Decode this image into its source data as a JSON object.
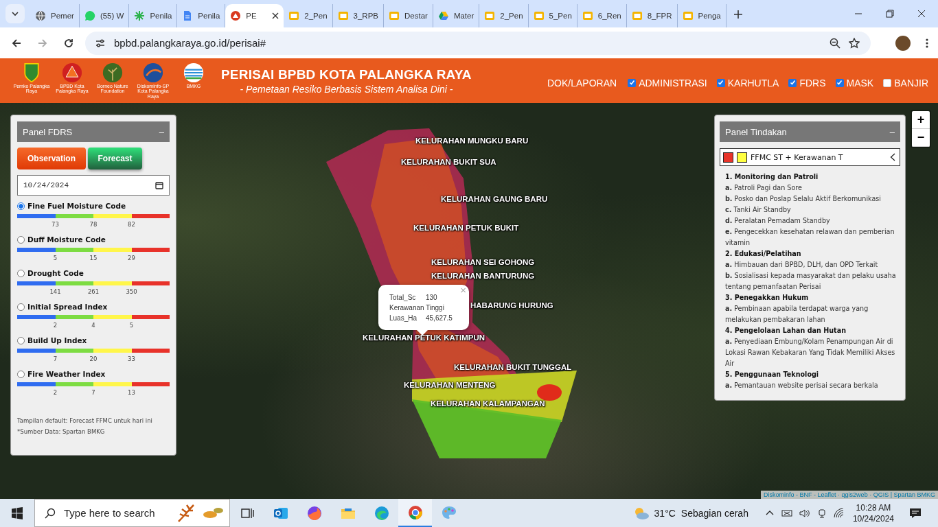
{
  "browser": {
    "tabs": [
      {
        "title": "Pemer",
        "kind": "globe",
        "selected": false
      },
      {
        "title": "(55) W",
        "kind": "chat",
        "selected": false
      },
      {
        "title": "Penila",
        "kind": "spark",
        "selected": false
      },
      {
        "title": "Penila",
        "kind": "doc",
        "selected": false
      },
      {
        "title": "PE",
        "kind": "emblem",
        "selected": true
      },
      {
        "title": "2_Pen",
        "kind": "slides",
        "selected": false
      },
      {
        "title": "3_RPB",
        "kind": "slides",
        "selected": false
      },
      {
        "title": "Destar",
        "kind": "slides",
        "selected": false
      },
      {
        "title": "Mater",
        "kind": "drive",
        "selected": false
      },
      {
        "title": "2_Pen",
        "kind": "slides",
        "selected": false
      },
      {
        "title": "5_Pen",
        "kind": "slides",
        "selected": false
      },
      {
        "title": "6_Ren",
        "kind": "slides",
        "selected": false
      },
      {
        "title": "8_FPR",
        "kind": "slides",
        "selected": false
      },
      {
        "title": "Penga",
        "kind": "slides",
        "selected": false
      }
    ],
    "url": "bpbd.palangkaraya.go.id/perisai#"
  },
  "header": {
    "logos": [
      {
        "caption": "Pemko Palangka Raya",
        "kind": "shield"
      },
      {
        "caption": "BPBD Kota Palangka Raya",
        "kind": "triangle"
      },
      {
        "caption": "Borneo Nature Foundation",
        "kind": "tree"
      },
      {
        "caption": "Diskominfo-SP Kota Palangka Raya",
        "kind": "swirl"
      },
      {
        "caption": "BMKG",
        "kind": "globe"
      }
    ],
    "title": "PERISAI BPBD KOTA PALANGKA RAYA",
    "subtitle": "- Pemetaan Resiko Berbasis Sistem Analisa Dini -",
    "nav": [
      {
        "label": "DOK/LAPORAN",
        "kind": "link"
      },
      {
        "label": "ADMINISTRASI",
        "kind": "checkbox",
        "checked": true
      },
      {
        "label": "KARHUTLA",
        "kind": "checkbox",
        "checked": true
      },
      {
        "label": "FDRS",
        "kind": "checkbox",
        "checked": true
      },
      {
        "label": "MASK",
        "kind": "checkbox",
        "checked": true
      },
      {
        "label": "BANJIR",
        "kind": "checkbox",
        "checked": false
      }
    ]
  },
  "fdrs_panel": {
    "title": "Panel FDRS",
    "collapse": "–",
    "buttons": [
      {
        "label": "Observation",
        "kind": "primary"
      },
      {
        "label": "Forecast",
        "kind": "secondary"
      }
    ],
    "date": "10/24/2024",
    "indices": [
      {
        "name": "Fine Fuel Moisture Code",
        "selected": true,
        "thresholds": [
          "73",
          "78",
          "82"
        ]
      },
      {
        "name": "Duff Moisture Code",
        "selected": false,
        "thresholds": [
          "5",
          "15",
          "29"
        ]
      },
      {
        "name": "Drought Code",
        "selected": false,
        "thresholds": [
          "141",
          "261",
          "350"
        ]
      },
      {
        "name": "Initial Spread Index",
        "selected": false,
        "thresholds": [
          "2",
          "4",
          "5"
        ]
      },
      {
        "name": "Build Up Index",
        "selected": false,
        "thresholds": [
          "7",
          "20",
          "33"
        ]
      },
      {
        "name": "Fire Weather Index",
        "selected": false,
        "thresholds": [
          "2",
          "7",
          "13"
        ]
      }
    ],
    "notes": [
      "Tampilan default: Forecast FFMC untuk hari ini",
      "*Sumber Data: Spartan BMKG"
    ]
  },
  "action_panel": {
    "title": "Panel Tindakan",
    "collapse": "–",
    "legend": {
      "label": "FFMC ST + Kerawanan T",
      "swatches": [
        {
          "color": "#e8342a"
        },
        {
          "color": "#ffff40"
        }
      ]
    },
    "sections": [
      {
        "heading": "1. Monitoring dan Patroli",
        "items": [
          "**a.** Patroli Pagi dan Sore",
          "**b.** Posko dan Poslap Selalu Aktif Berkomunikasi",
          "**c.** Tanki Air Standby",
          "**d.** Peralatan Pemadam Standby",
          "**e.** Pengecekkan kesehatan relawan dan pemberian vitamin"
        ]
      },
      {
        "heading": "2. Edukasi/Pelatihan",
        "items": [
          "**a.** Himbauan dari BPBD, DLH, dan OPD Terkait",
          "**b.** Sosialisasi kepada masyarakat dan pelaku usaha tentang pemanfaatan Perisai"
        ]
      },
      {
        "heading": "3. Penegakkan Hukum",
        "items": [
          "**a.** Pembinaan apabila terdapat warga yang melakukan pembakaran lahan"
        ]
      },
      {
        "heading": "4. Pengelolaan Lahan dan Hutan",
        "items": [
          "**a.** Penyediaan Embung/Kolam Penampungan Air di Lokasi Rawan Kebakaran Yang Tidak Memiliki Akses Air"
        ]
      },
      {
        "heading": "5. Penggunaan Teknologi",
        "items": [
          "**a.** Pemantauan website perisai secara berkala"
        ]
      }
    ]
  },
  "map": {
    "labels": [
      {
        "text": "KELURAHAN MUNGKU BARU"
      },
      {
        "text": "KELURAHAN BUKIT SUA"
      },
      {
        "text": "KELURAHAN GAUNG BARU"
      },
      {
        "text": "KELURAHAN PETUK BUKIT"
      },
      {
        "text": "KELURAHAN SEI GOHONG"
      },
      {
        "text": "KELURAHAN BANTURUNG"
      },
      {
        "text": "HABARUNG HURUNG"
      },
      {
        "text": "KELURAHAN PETUK KATIMPUN"
      },
      {
        "text": "KELURAHAN BUKIT TUNGGAL"
      },
      {
        "text": "KELURAHAN MENTENG"
      },
      {
        "text": "KELURAHAN KALAMPANGAN"
      }
    ],
    "popup": {
      "close": "×",
      "rows": [
        {
          "key": "Total_Sc",
          "value": "130"
        },
        {
          "key": "Kerawanan",
          "value": "Tinggi"
        },
        {
          "key": "Luas_Ha",
          "value": "45,627.5"
        }
      ]
    },
    "zoom": [
      "+",
      "−"
    ],
    "attribution": "Diskominfo - BNF - Leaflet · qgis2web · QGIS | Spartan BMKG"
  },
  "taskbar": {
    "search": {
      "placeholder": "Type here to search"
    },
    "apps": [
      {
        "kind": "taskview",
        "selected": false
      },
      {
        "kind": "mail",
        "selected": false
      },
      {
        "kind": "fox",
        "selected": false
      },
      {
        "kind": "folder",
        "selected": false
      },
      {
        "kind": "edge",
        "selected": false
      },
      {
        "kind": "chrome",
        "selected": true
      },
      {
        "kind": "paint",
        "selected": false
      }
    ],
    "weather": {
      "temp": "31°C",
      "text": "Sebagian cerah"
    },
    "time": "10:28 AM",
    "date": "10/24/2024"
  }
}
